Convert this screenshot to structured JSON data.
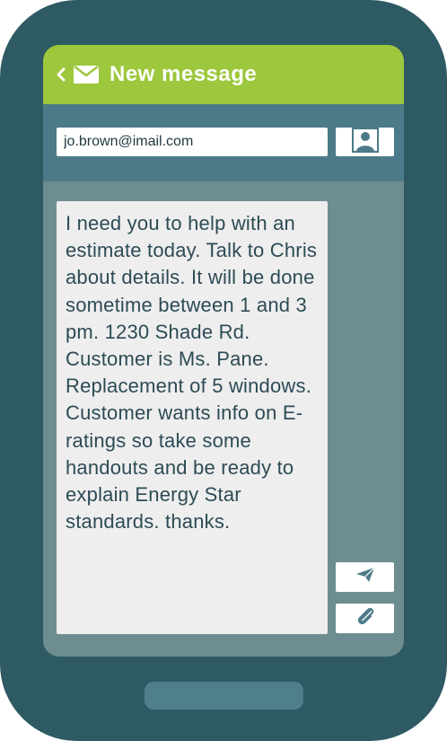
{
  "header": {
    "back_icon": "chevron-left-icon",
    "mail_icon": "envelope-icon",
    "title": "New message"
  },
  "recipient": {
    "value": "jo.brown@imail.com",
    "contact_icon": "person-icon"
  },
  "message": {
    "text": "I need you to help with an estimate today. Talk to Chris about details. It will be done sometime between 1 and 3 pm. 1230 Shade Rd. Customer is Ms. Pane. Replacement of 5 windows. Customer wants info on E-ratings so take some handouts and be ready to explain Energy Star standards. thanks."
  },
  "actions": {
    "send_icon": "paper-plane-icon",
    "attach_icon": "paperclip-icon"
  },
  "colors": {
    "phone_body": "#2e5a63",
    "header": "#9dc73c",
    "to_bar": "#4d7a88",
    "screen_bg": "#6e8d91",
    "message_bg": "#eeeeee",
    "text": "#2d4b55",
    "home_button": "#4f7f8c"
  }
}
